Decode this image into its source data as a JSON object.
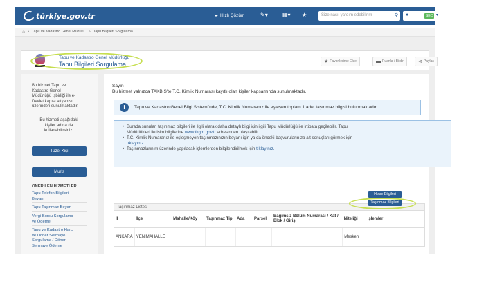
{
  "topbar": {
    "logo_text": "türkiye.gov.tr",
    "hizli_cozum": "Hızlı Çözüm",
    "search_placeholder": "Size nasıl yardım edebilirim",
    "user_badge": "SEÇ"
  },
  "breadcrumb": {
    "items": [
      "Tapu ve Kadastro Genel Müdürl...",
      "Tapu Bilgileri Sorgulama"
    ]
  },
  "header": {
    "org_name": "Tapu ve Kadastro Genel Müdürlüğü",
    "title": "Tapu Bilgileri Sorgulama",
    "buttons": [
      "Favorilerime Ekle",
      "Puanla / Bildir",
      "Paylaş"
    ]
  },
  "sidebar": {
    "intro": [
      "Bu hizmet Tapu ve",
      "Kadastro Genel",
      "Müdürlüğü işbirliği ile e-",
      "Devlet kapısı altyapısı",
      "üzerinden sunulmaktadır."
    ],
    "persons_text": [
      "Bu hizmeti aşağıdaki",
      "kişiler adına da",
      "kullanabilirsiniz."
    ],
    "btn_tuzel": "Tüzel Kişi",
    "btn_muris": "Muris",
    "recommended_heading": "ÖNERİLEN HİZMETLER",
    "links": [
      [
        "Tapu Telefon Bilgileri",
        "Beyan"
      ],
      [
        "Tapu Taşınmaz Beyan"
      ],
      [
        "Vergi Borcu Sorgulama",
        "ve Ödeme"
      ],
      [
        "Tapu ve Kadastro Harç",
        "ve Döner Sermaye",
        "Sorgulama / Döner",
        "Sermaye Ödeme"
      ]
    ]
  },
  "main": {
    "greeting": "Sayın",
    "greeting_line2": "Bu hizmet yalnızca TAKBİS'te T.C. Kimlik Numarası kayıtlı olan kişiler kapsamında sunulmaktadır.",
    "info_text": "Tapu ve Kadastro Genel Bilgi Sistemi'nde, T.C. Kimlik Numaranız ile eşleşen toplam 1 adet taşınmaz bilgisi bulunmaktadır.",
    "list": {
      "item1_line1": "Burada sunulan taşınmaz bilgileri ile ilgili olarak daha detaylı bilgi için ilgili Tapu Müdürlüğü ile irtibata geçilebilir. Tapu",
      "item1_line2_pre": "Müdürlükleri iletişim bilgilerine ",
      "item1_link": "www.tkgm.gov.tr",
      "item1_line2_post": " adresinden ulaşılabilir.",
      "item2_line1": "T.C. Kimlik Numaranız ile eşleşmeyen taşınmazınızın beyanı için ya da önceki başvurularınıza ait sonuçları görmek için",
      "item2_link": "tıklayınız.",
      "item3_pre": "Taşınmazlarınım üzerinde yapılacak işlemlerden bilgilendirilmek için ",
      "item3_link": "tıklayınız."
    },
    "table": {
      "title": "Taşınmaz Listesi",
      "headers": [
        "İl",
        "İlçe",
        "Mahalle/Köy",
        "Taşınmaz Tipi",
        "Ada",
        "Parsel",
        "Bağımsız Bölüm Numarası / Kat / Blok / Giriş",
        "Niteliği",
        "İşlemler"
      ],
      "row": [
        "ANKARA",
        "YENİMAHALLE",
        "",
        "",
        "",
        "",
        "",
        "Mesken"
      ],
      "btn_hisse": "Hisse Bilgileri",
      "btn_tasinmaz": "Taşınmaz Bilgileri"
    }
  }
}
